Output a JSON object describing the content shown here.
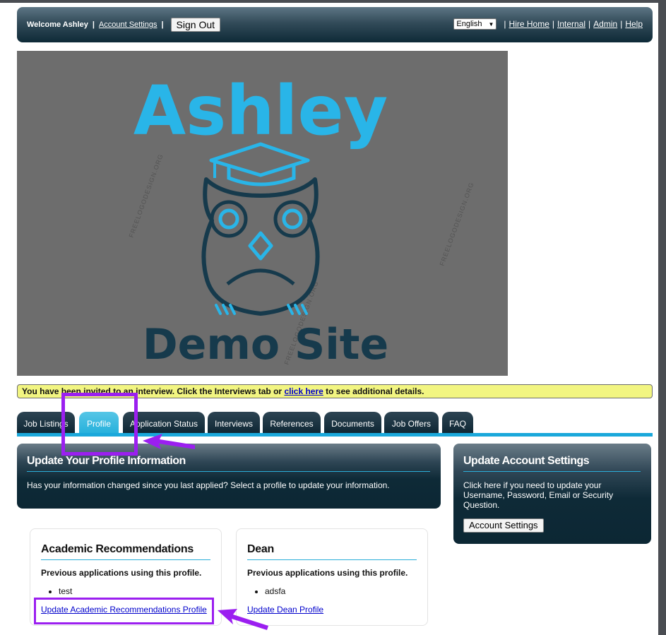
{
  "header": {
    "welcome": "Welcome Ashley",
    "account_settings_link": "Account Settings",
    "sign_out": "Sign Out",
    "language": "English",
    "links": [
      "Hire Home",
      "Internal",
      "Admin",
      "Help"
    ]
  },
  "banner": {
    "title": "Ashley",
    "subtitle": "Demo Site",
    "primary_color": "#29b5e8",
    "dark_color": "#163a4c",
    "background": "#6d6d6d"
  },
  "notice": {
    "text_before": "You have been invited to an interview. Click the Interviews tab or ",
    "link": "click here",
    "text_after": " to see additional details."
  },
  "tabs": [
    {
      "label": "Job Listings"
    },
    {
      "label": "Profile"
    },
    {
      "label": "Application Status"
    },
    {
      "label": "Interviews"
    },
    {
      "label": "References"
    },
    {
      "label": "Documents"
    },
    {
      "label": "Job Offers"
    },
    {
      "label": "FAQ"
    }
  ],
  "active_tab": "Profile",
  "profile_panel": {
    "title": "Update Your Profile Information",
    "text": "Has your information changed since you last applied? Select a profile to update your information."
  },
  "account_panel": {
    "title": "Update Account Settings",
    "text": "Click here if you need to update your Username, Password, Email or Security Question.",
    "button": "Account Settings"
  },
  "profiles": [
    {
      "name": "Academic Recommendations",
      "prev_label": "Previous applications using this profile.",
      "applications": [
        "test"
      ],
      "update_link": "Update Academic Recommendations Profile"
    },
    {
      "name": "Dean",
      "prev_label": "Previous applications using this profile.",
      "applications": [
        "adsfa"
      ],
      "update_link": "Update Dean Profile"
    }
  ],
  "annotation_color": "#9b1ff0"
}
